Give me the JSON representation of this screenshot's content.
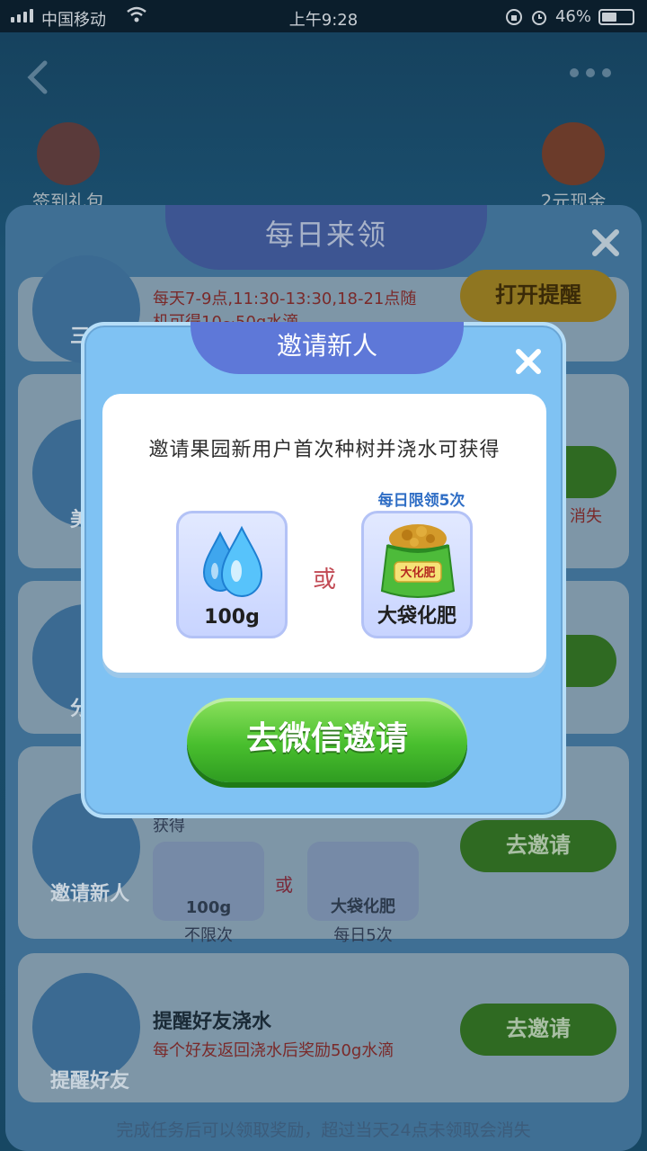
{
  "status_bar": {
    "carrier": "中国移动",
    "time": "上午9:28",
    "battery": "46%"
  },
  "background": {
    "top_left_badge": "签到礼包",
    "top_right_badge": "2元现金",
    "panel_title": "每日来领",
    "tasks": [
      {
        "name": "三餐",
        "desc_line1": "每天7-9点,11:30-13:30,18-21点随",
        "desc_line2": "机可得10~50g水滴",
        "button": "打开提醒"
      },
      {
        "name": "美团",
        "desc_fragment": "消失"
      },
      {
        "name": "分享"
      },
      {
        "name": "邀请新人",
        "desc_fragment": "获得",
        "reward_water": "100g",
        "reward_water_cap": "不限次",
        "or": "或",
        "reward_fert": "大袋化肥",
        "reward_fert_cap": "每日5次",
        "button": "去邀请"
      },
      {
        "name": "提醒好友",
        "title": "提醒好友浇水",
        "desc": "每个好友返回浇水后奖励50g水滴",
        "button": "去邀请"
      }
    ],
    "footer_note": "完成任务后可以领取奖励，超过当天24点未领取会消失"
  },
  "modal": {
    "title": "邀请新人",
    "description": "邀请果园新用户首次种树并浇水可获得",
    "limit_note": "每日限领5次",
    "reward_water_label": "100g",
    "or_text": "或",
    "reward_fert_label": "大袋化肥",
    "bag_text": "大化肥",
    "button": "去微信邀请"
  },
  "colors": {
    "modal_bg": "#7fc2f3",
    "modal_tab": "#5e78d8",
    "invite_btn": "#49bf2e",
    "or_text": "#c24a54",
    "limit_note": "#2f6ec5"
  }
}
